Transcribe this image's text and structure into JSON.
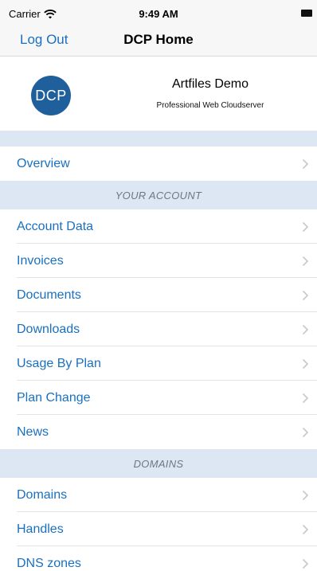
{
  "status_bar": {
    "carrier": "Carrier",
    "time": "9:49 AM",
    "wifi_icon": "wifi-icon",
    "battery_icon": "battery-icon"
  },
  "nav": {
    "logout_label": "Log Out",
    "title": "DCP Home"
  },
  "profile": {
    "avatar_text": "DCP",
    "name": "Artfiles Demo",
    "subtitle": "Professional Web Cloudserver"
  },
  "menu": {
    "overview": "Overview",
    "sections": [
      {
        "title": "YOUR ACCOUNT",
        "items": [
          "Account Data",
          "Invoices",
          "Documents",
          "Downloads",
          "Usage By Plan",
          "Plan Change",
          "News"
        ]
      },
      {
        "title": "DOMAINS",
        "items": [
          "Domains",
          "Handles",
          "DNS zones"
        ]
      }
    ]
  },
  "colors": {
    "accent": "#1a70c0",
    "section_bg": "#dde7f4",
    "avatar_bg": "#1f5f9b"
  }
}
